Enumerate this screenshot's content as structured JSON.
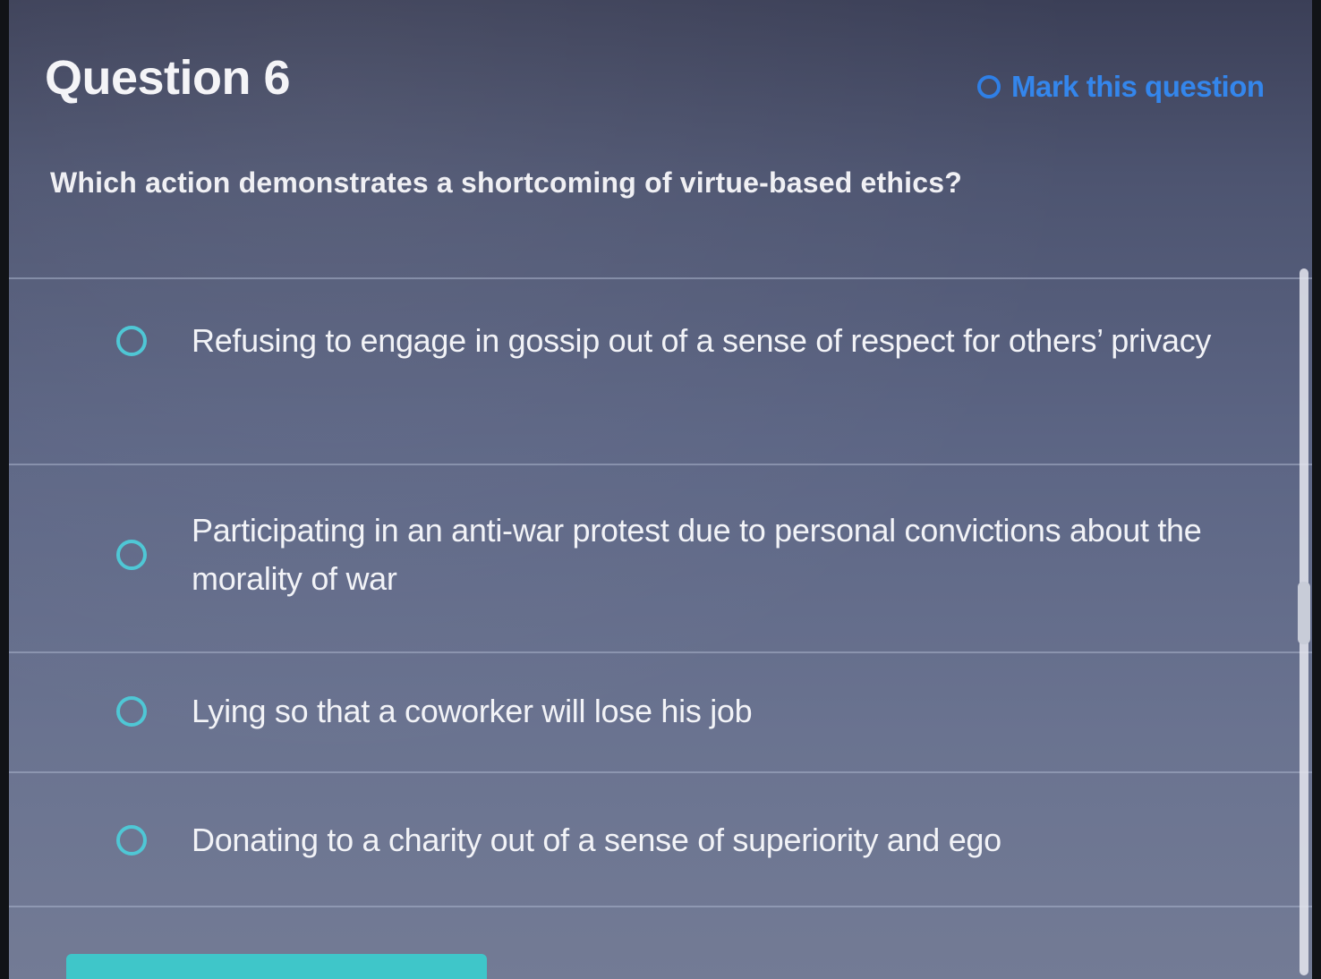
{
  "header": {
    "title": "Question 6",
    "mark_label": "Mark this question"
  },
  "question": {
    "text": "Which action demonstrates a shortcoming of virtue-based ethics?"
  },
  "options": [
    {
      "text": "Refusing to engage in gossip out of a sense of respect for others’ privacy"
    },
    {
      "text": "Participating in an anti-war protest due to personal convictions about the morality of war"
    },
    {
      "text": "Lying so that a coworker will lose his job"
    },
    {
      "text": "Donating to a charity out of a sense of superiority and ego"
    }
  ],
  "colors": {
    "accent": "#3486ec",
    "radio": "#4fc7d5",
    "button": "#3fc6c9"
  },
  "icons": {
    "mark": "circle-outline-icon",
    "radio": "radio-circle-icon"
  }
}
